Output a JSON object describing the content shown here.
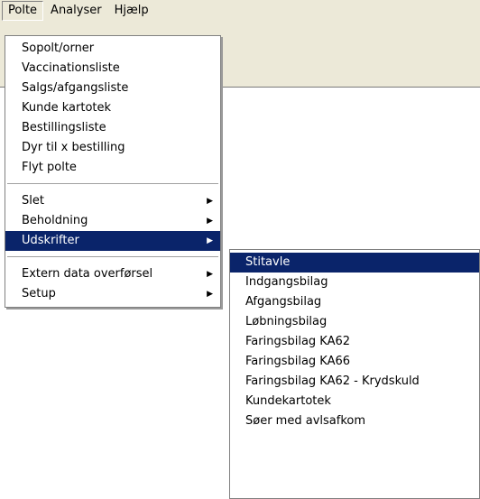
{
  "menubar": {
    "items": [
      {
        "label": "Polte"
      },
      {
        "label": "Analyser"
      },
      {
        "label": "Hjælp"
      }
    ]
  },
  "main_menu": {
    "group1": [
      "Sopolt/orner",
      "Vaccinationsliste",
      "Salgs/afgangsliste",
      "Kunde kartotek",
      "Bestillingsliste",
      "Dyr til x bestilling",
      "Flyt polte"
    ],
    "group2": [
      "Slet",
      "Beholdning",
      "Udskrifter"
    ],
    "group3": [
      "Extern data overførsel",
      "Setup"
    ],
    "submenu_arrow": "▶",
    "selected": "Udskrifter"
  },
  "sub_menu": {
    "items": [
      "Stitavle",
      "Indgangsbilag",
      "Afgangsbilag",
      "Løbningsbilag",
      "Faringsbilag  KA62",
      "Faringsbilag KA66",
      "Faringsbilag KA62 - Krydskuld",
      "Kundekartotek",
      "Søer med avlsafkom"
    ],
    "selected": "Stitavle"
  },
  "colors": {
    "menubar_bg": "#ece9d8",
    "highlight": "#0a246a",
    "menu_bg": "#ffffff"
  }
}
